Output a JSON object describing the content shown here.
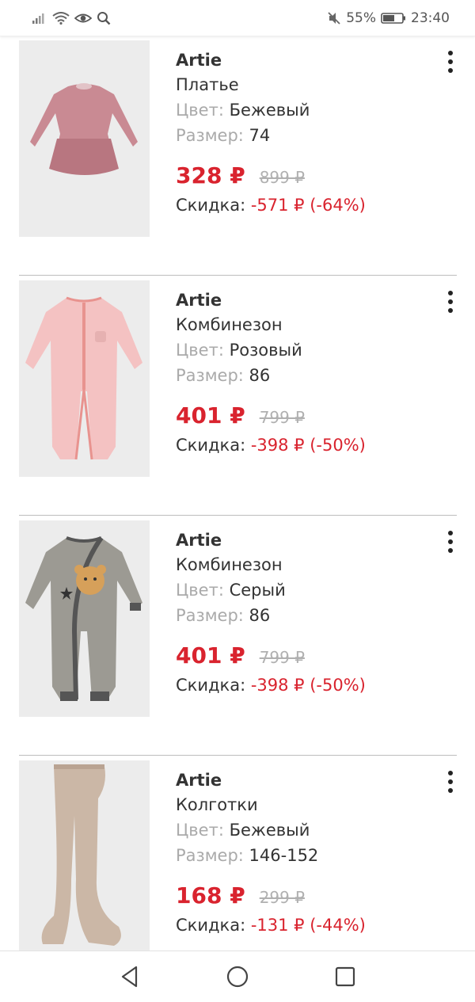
{
  "status_bar": {
    "battery_percent": "55%",
    "time": "23:40",
    "icons": [
      "signal-icon",
      "wifi-icon",
      "eye-icon",
      "search-icon",
      "mute-icon",
      "battery-icon"
    ]
  },
  "products": [
    {
      "brand": "Artie",
      "name": "Платье",
      "color_label": "Цвет:",
      "color_value": " Бежевый",
      "size_label": "Размер:",
      "size_value": " 74",
      "price": "328 ₽",
      "old_price": "899 ₽",
      "discount_label": "Скидка: ",
      "discount_value": "-571 ₽ (-64%)",
      "image": "dress-image"
    },
    {
      "brand": "Artie",
      "name": "Комбинезон",
      "color_label": "Цвет:",
      "color_value": " Розовый",
      "size_label": "Размер:",
      "size_value": " 86",
      "price": "401 ₽",
      "old_price": "799 ₽",
      "discount_label": "Скидка: ",
      "discount_value": "-398 ₽ (-50%)",
      "image": "pink-romper-image"
    },
    {
      "brand": "Artie",
      "name": "Комбинезон",
      "color_label": "Цвет:",
      "color_value": " Серый",
      "size_label": "Размер:",
      "size_value": " 86",
      "price": "401 ₽",
      "old_price": "799 ₽",
      "discount_label": "Скидка: ",
      "discount_value": "-398 ₽ (-50%)",
      "image": "grey-romper-image"
    },
    {
      "brand": "Artie",
      "name": "Колготки",
      "color_label": "Цвет:",
      "color_value": " Бежевый",
      "size_label": "Размер:",
      "size_value": " 146-152",
      "price": "168 ₽",
      "old_price": "299 ₽",
      "discount_label": "Скидка: ",
      "discount_value": "-131 ₽ (-44%)",
      "image": "tights-image"
    }
  ],
  "colors": {
    "price_red": "#d9232e",
    "label_grey": "#aaaaaa",
    "text_dark": "#333333"
  },
  "nav_bar": {
    "buttons": [
      "back-icon",
      "home-icon",
      "recents-icon"
    ]
  }
}
